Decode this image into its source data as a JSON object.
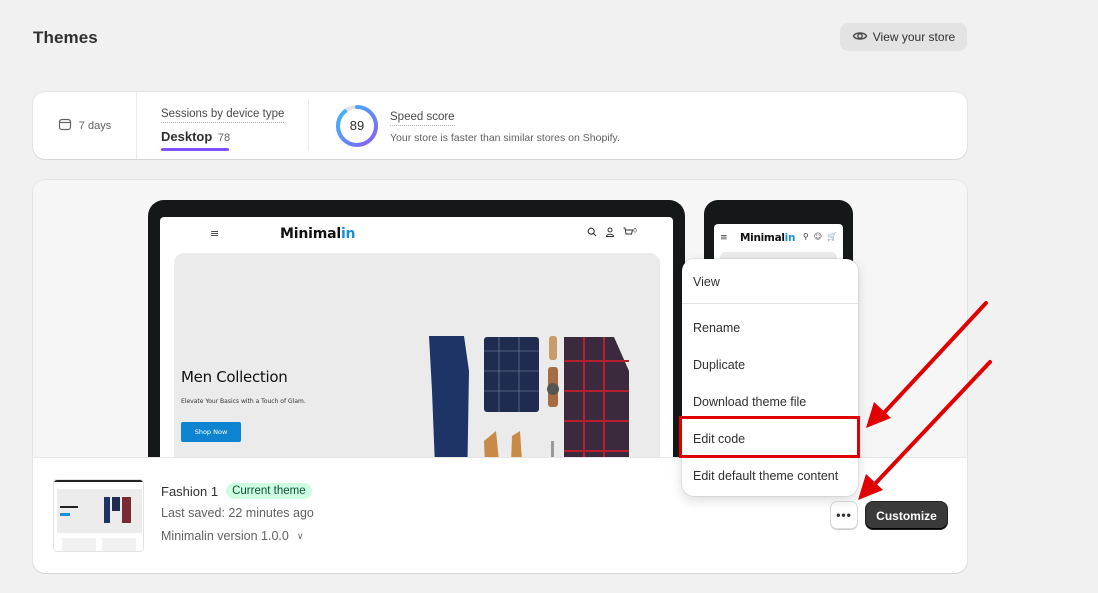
{
  "page": {
    "title": "Themes",
    "view_store_label": "View your store"
  },
  "stats": {
    "range_label": "7 days",
    "sessions_label": "Sessions by device type",
    "sessions_device": "Desktop",
    "sessions_value": "78",
    "speed_score": "89",
    "speed_score_percent": 89,
    "speed_label": "Speed score",
    "speed_desc": "Your store is faster than similar stores on Shopify.",
    "colors": {
      "tab_underline": "#8051ff",
      "gauge_start": "#8b5cf6",
      "gauge_end": "#38bdf8"
    }
  },
  "preview": {
    "store_logo_main": "Minimal",
    "store_logo_accent": "in",
    "menu_icon": "≡",
    "header_icons": [
      "search-icon",
      "user-icon",
      "cart-icon"
    ],
    "cart_count": "0",
    "hero_title": "Men Collection",
    "hero_subtitle": "Elevate Your Basics with a Touch of Glam.",
    "hero_button": "Shop Now",
    "accent_color": "#1c8fd6"
  },
  "theme": {
    "name": "Fashion 1",
    "badge": "Current theme",
    "last_saved": "Last saved: 22 minutes ago",
    "version": "Minimalin version 1.0.0",
    "more_label": "•••",
    "customize_label": "Customize"
  },
  "menu": {
    "items": [
      {
        "label": "View"
      },
      {
        "label": "Rename"
      },
      {
        "label": "Duplicate"
      },
      {
        "label": "Download theme file"
      },
      {
        "label": "Edit code",
        "highlighted": true
      },
      {
        "label": "Edit default theme content"
      }
    ]
  },
  "annotation": {
    "highlight_color": "#e10000"
  }
}
